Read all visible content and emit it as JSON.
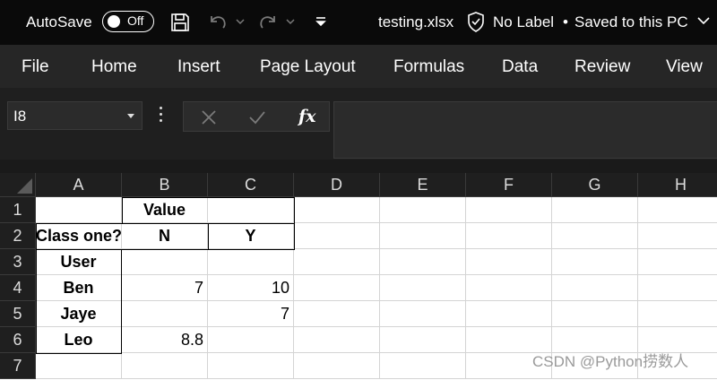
{
  "titlebar": {
    "autosave_label": "AutoSave",
    "autosave_state": "Off",
    "filename": "testing.xlsx",
    "sensitivity": "No Label",
    "save_status": "Saved to this PC"
  },
  "ribbon": {
    "tabs": [
      "File",
      "Home",
      "Insert",
      "Page Layout",
      "Formulas",
      "Data",
      "Review",
      "View"
    ]
  },
  "formula_bar": {
    "name_box": "I8",
    "fx_label": "fx",
    "formula": ""
  },
  "sheet": {
    "columns": [
      "A",
      "B",
      "C",
      "D",
      "E",
      "F",
      "G",
      "H"
    ],
    "rows": [
      "1",
      "2",
      "3",
      "4",
      "5",
      "6",
      "7"
    ],
    "cells": {
      "B1": "Value",
      "A2": "Class one?",
      "B2": "N",
      "C2": "Y",
      "A3": "User",
      "A4": "Ben",
      "B4": "7",
      "C4": "10",
      "A5": "Jaye",
      "C5": "7",
      "A6": "Leo",
      "B6": "8.8"
    }
  },
  "watermark": "CSDN @Python捞数人",
  "colors": {
    "titlebar_bg": "#0a0a0a",
    "ribbon_bg": "#262626",
    "header_bg": "#1f1f1f",
    "grid_line": "#d4d4d4"
  }
}
